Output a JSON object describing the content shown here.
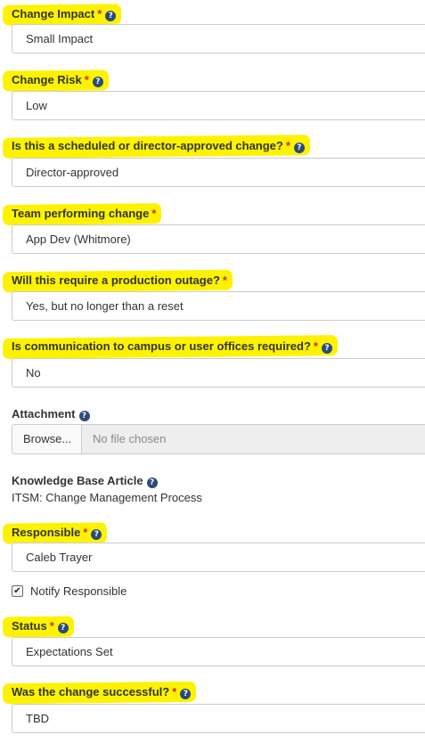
{
  "colors": {
    "highlight": "#fdf300",
    "required": "#c9302c",
    "help_icon": "#2a4b7c",
    "border": "#cccccc"
  },
  "fields": {
    "change_impact": {
      "label": "Change Impact",
      "value": "Small Impact"
    },
    "change_risk": {
      "label": "Change Risk",
      "value": "Low"
    },
    "scheduled": {
      "label": "Is this a scheduled or director-approved change?",
      "value": "Director-approved"
    },
    "team": {
      "label": "Team performing change",
      "value": "App Dev (Whitmore)"
    },
    "outage": {
      "label": "Will this require a production outage?",
      "value": "Yes, but no longer than a reset"
    },
    "communication": {
      "label": "Is communication to campus or user offices required?",
      "value": "No"
    },
    "attachment": {
      "label": "Attachment",
      "browse_label": "Browse...",
      "status": "No file chosen"
    },
    "kb_article": {
      "label": "Knowledge Base Article",
      "value": "ITSM: Change Management Process"
    },
    "responsible": {
      "label": "Responsible",
      "value": "Caleb Trayer"
    },
    "notify": {
      "label": "Notify Responsible",
      "checked": true,
      "check_glyph": "✔"
    },
    "status": {
      "label": "Status",
      "value": "Expectations Set"
    },
    "successful": {
      "label": "Was the change successful?",
      "value": "TBD"
    }
  },
  "marks": {
    "required": "*",
    "help_glyph": "?"
  }
}
